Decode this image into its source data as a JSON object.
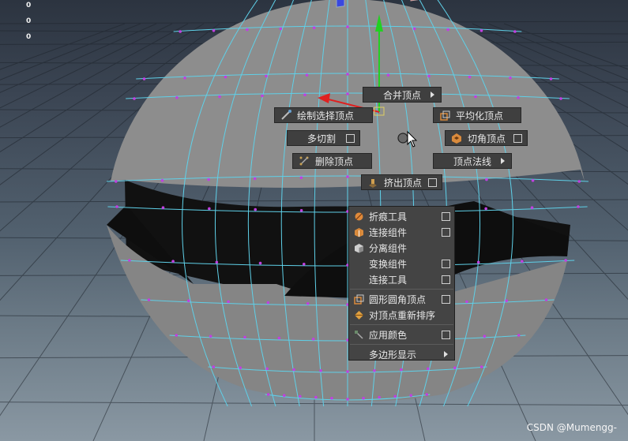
{
  "hud": {
    "values": [
      "0",
      "0",
      "0"
    ]
  },
  "marking_menu": {
    "north": {
      "label": "合并顶点",
      "icon": "arrow-right-icon"
    },
    "northwest": {
      "label": "绘制选择顶点",
      "icon": "paint-brush-icon"
    },
    "northeast": {
      "label": "平均化顶点",
      "icon": "average-vertices-icon"
    },
    "west": {
      "label": "多切割",
      "icon": "option-box-icon"
    },
    "east": {
      "label": "切角顶点",
      "icon": "chamfer-icon"
    },
    "southwest": {
      "label": "删除顶点",
      "icon": "delete-vertex-icon"
    },
    "southeast": {
      "label": "顶点法线",
      "icon": "arrow-right-icon"
    },
    "south": {
      "label": "挤出顶点",
      "icon": "extrude-icon"
    }
  },
  "context_menu": {
    "items": [
      {
        "label": "折痕工具",
        "icon": "crease-icon",
        "color": "#e08a3a"
      },
      {
        "label": "连接组件",
        "icon": "connect-components-icon",
        "color": "#d98a3c"
      },
      {
        "label": "分离组件",
        "icon": "detach-components-icon",
        "color": "#cfcfcf"
      },
      {
        "label": "变换组件",
        "icon": ""
      },
      {
        "label": "连接工具",
        "icon": ""
      },
      {
        "label": "圆形圆角顶点",
        "icon": "circularize-icon",
        "color": "#d98a3c"
      },
      {
        "label": "对顶点重新排序",
        "icon": "reorder-vertices-icon",
        "color": "#e0a040"
      },
      {
        "label": "应用颜色",
        "icon": "apply-color-icon"
      },
      {
        "label": "多边形显示",
        "icon": ""
      }
    ]
  },
  "watermark": "CSDN @Mumengg-",
  "colors": {
    "wire": "#5fd0e8",
    "vertex": "#c040e0",
    "menu_bg": "#3f3f3f"
  }
}
